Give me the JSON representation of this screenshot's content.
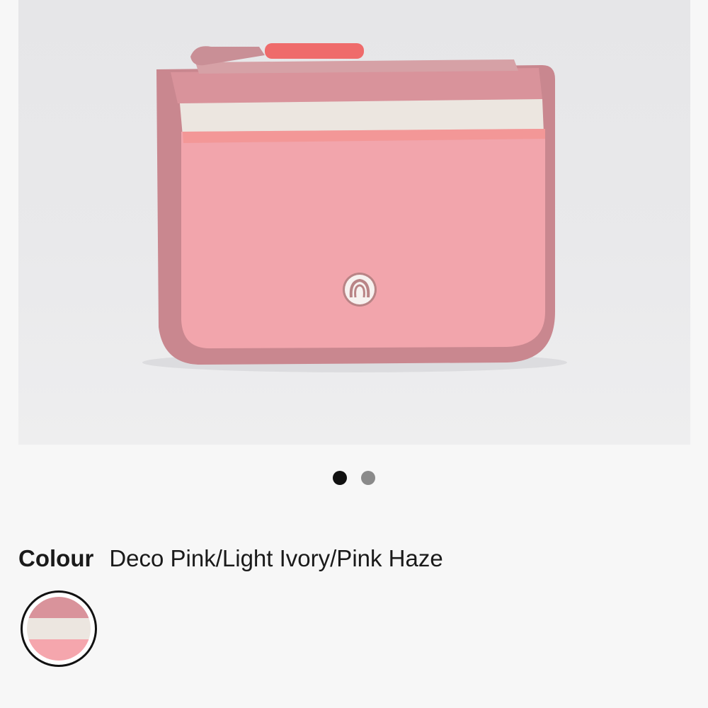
{
  "product": {
    "image": {
      "alt": "",
      "colors": {
        "background": "#e8e8ea",
        "binding": "#c9878f",
        "zipper_band": "#d9939b",
        "ivory_stripe": "#ece6e0",
        "body": "#f2a5ac",
        "pull_tab": "#ef6b6b",
        "logo": "#ffffff"
      }
    },
    "carousel": {
      "dots": [
        {
          "state": "active"
        },
        {
          "state": "inactive"
        }
      ]
    },
    "colour": {
      "label": "Colour",
      "value": "Deco Pink/Light Ivory/Pink Haze",
      "swatches": [
        {
          "name": "deco-pink-light-ivory-pink-haze",
          "selected": true,
          "bands": [
            "#d9939b",
            "#ece6e0",
            "#f5a6ad"
          ]
        }
      ]
    }
  }
}
